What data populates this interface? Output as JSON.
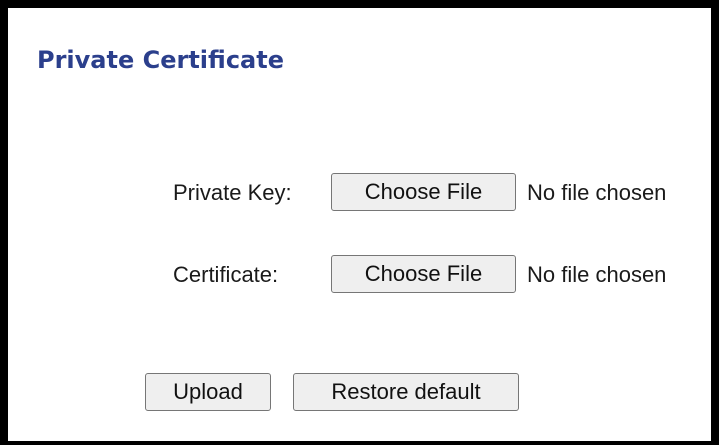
{
  "panel": {
    "title": "Private Certificate"
  },
  "form": {
    "private_key": {
      "label": "Private Key:",
      "button_label": "Choose File",
      "status": "No file chosen"
    },
    "certificate": {
      "label": "Certificate:",
      "button_label": "Choose File",
      "status": "No file chosen"
    }
  },
  "actions": {
    "upload_label": "Upload",
    "restore_label": "Restore default"
  }
}
